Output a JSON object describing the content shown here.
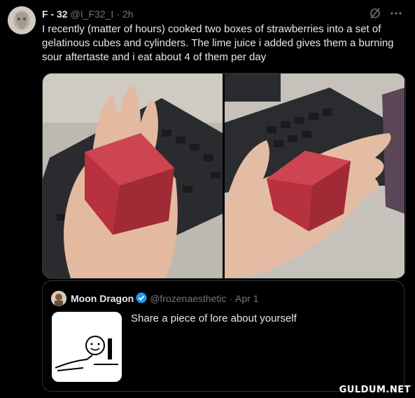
{
  "tweet": {
    "author_name": "F - 32",
    "handle": "@I_F32_I",
    "separator": "·",
    "time": "2h",
    "text": "I recently (matter of hours) cooked two boxes of strawberries into a set of gelatinous cubes and cylinders. The lime juice i added gives them a burning sour aftertaste and i eat about 4 of them per day"
  },
  "quote": {
    "author_name": "Moon Dragon",
    "handle": "@frozenaesthetic",
    "separator": "·",
    "date": "Apr 1",
    "text": "Share a piece of lore about yourself"
  },
  "watermark": "GULDUM.NET",
  "colors": {
    "background": "#000000",
    "text": "#e7e9ea",
    "muted": "#71767b",
    "verified": "#1d9bf0",
    "border": "#2f3336"
  },
  "icons": [
    "grok-icon",
    "more-icon",
    "verified-badge-icon"
  ]
}
